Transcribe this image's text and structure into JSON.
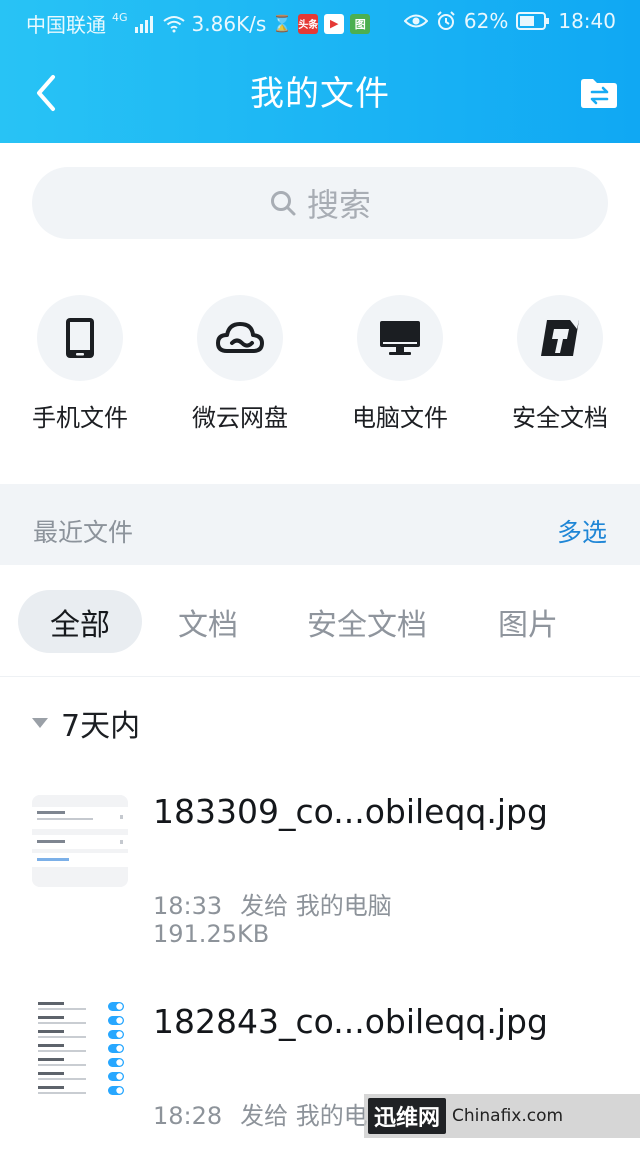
{
  "status_bar": {
    "carrier": "中国联通",
    "network": "4G",
    "speed": "3.86K/s",
    "app_badge_1": "头条",
    "app_badge_2": "▶",
    "app_badge_3": "图",
    "battery": "62%",
    "time": "18:40"
  },
  "header": {
    "title": "我的文件"
  },
  "search": {
    "placeholder": "搜索"
  },
  "quick_access": [
    {
      "label": "手机文件",
      "icon": "phone-icon"
    },
    {
      "label": "微云网盘",
      "icon": "cloud-icon"
    },
    {
      "label": "电脑文件",
      "icon": "monitor-icon"
    },
    {
      "label": "安全文档",
      "icon": "secure-doc-icon"
    }
  ],
  "recent": {
    "title": "最近文件",
    "action": "多选"
  },
  "tabs": [
    {
      "label": "全部",
      "active": true
    },
    {
      "label": "文档",
      "active": false
    },
    {
      "label": "安全文档",
      "active": false
    },
    {
      "label": "图片",
      "active": false
    }
  ],
  "section": {
    "label": "7天内"
  },
  "files": [
    {
      "name": "183309_co...obileqq.jpg",
      "time": "18:33",
      "sent_to": "发给 我的电脑",
      "size": "191.25KB"
    },
    {
      "name": "182843_co...obileqq.jpg",
      "time": "18:28",
      "sent_to": "发给 我的电脑",
      "size": ""
    }
  ],
  "watermark": {
    "brand": "迅维网",
    "text": "Chinafix.com"
  },
  "colors": {
    "header_start": "#28c3f5",
    "header_end": "#10a8f3",
    "accent": "#1f86d6",
    "toggle_blue": "#27a7ff"
  }
}
